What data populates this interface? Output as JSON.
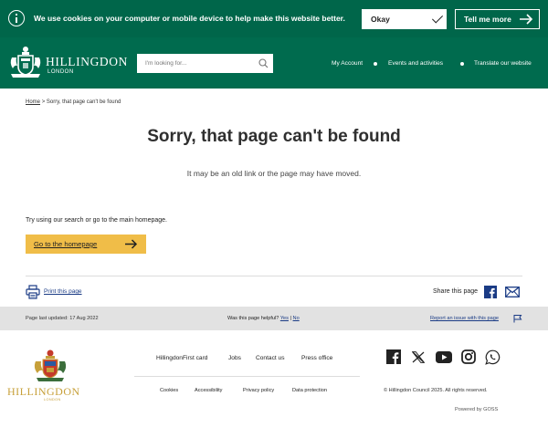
{
  "cookie_bar": {
    "message": "We use cookies on your computer or mobile device to help make this website better.",
    "okay_label": "Okay",
    "tell_me_more_label": "Tell me more"
  },
  "header": {
    "logo_name": "HILLINGDON",
    "logo_sub": "LONDON",
    "search_placeholder": "I'm looking for...",
    "nav": [
      "My Account",
      "Events and activities",
      "Translate our website"
    ]
  },
  "breadcrumb": {
    "home": "Home",
    "separator": ">",
    "current": "Sorry, that page can't be found"
  },
  "main": {
    "title": "Sorry, that page can't be found",
    "lead": "It may be an old link or the page may have moved.",
    "hint": "Try using our search or go to the main homepage.",
    "home_button": "Go to the homepage",
    "print_label": "Print this page",
    "share_label": "Share this page"
  },
  "grey_bar": {
    "last_updated": "Page last updated: 17 Aug 2022",
    "helpful_question": "Was this page helpful?",
    "yes": "Yes",
    "separator": "|",
    "no": "No",
    "report": "Report an issue with this page"
  },
  "footer": {
    "logo_name": "HILLINGDON",
    "logo_sub": "LONDON",
    "links_primary": [
      "HillingdonFirst card",
      "Jobs",
      "Contact us",
      "Press office"
    ],
    "links_secondary": [
      "Cookies",
      "Accessibility",
      "Privacy policy",
      "Data protection"
    ],
    "social_icons": [
      "facebook-icon",
      "x-icon",
      "youtube-icon",
      "instagram-icon",
      "whatsapp-icon"
    ],
    "copyright": "© Hillingdon Council 2025. All rights reserved.",
    "powered_by": "Powered by GOSS"
  },
  "colors": {
    "brand_green": "#006b4e",
    "cookie_green": "#00664a",
    "button_yellow": "#f0bd48",
    "link_blue": "#1a3b85",
    "crest_gold": "#c7a03a"
  }
}
